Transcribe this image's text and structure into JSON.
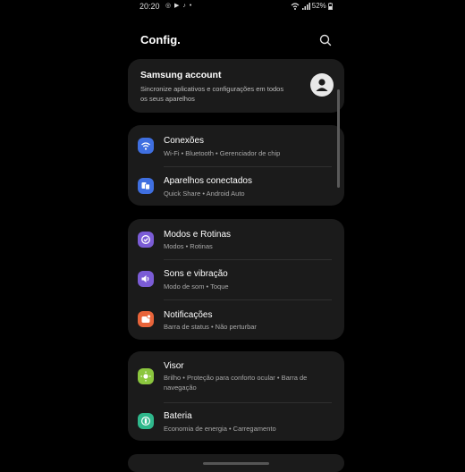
{
  "status": {
    "time": "20:20",
    "left_icons": "◎ ▶ ♪ •",
    "right": "52%"
  },
  "header": {
    "title": "Config."
  },
  "account": {
    "title": "Samsung account",
    "subtitle": "Sincronize aplicativos e configurações em todos os seus aparelhos"
  },
  "group1": [
    {
      "title": "Conexões",
      "subtitle": "Wi-Fi  •  Bluetooth  •  Gerenciador de chip",
      "icon": "wifi-icon",
      "color": "#3f6fe0"
    },
    {
      "title": "Aparelhos conectados",
      "subtitle": "Quick Share  •  Android Auto",
      "icon": "devices-icon",
      "color": "#3f6fe0"
    }
  ],
  "group2": [
    {
      "title": "Modos e Rotinas",
      "subtitle": "Modos  •  Rotinas",
      "icon": "modes-icon",
      "color": "#7b5cd6"
    },
    {
      "title": "Sons e vibração",
      "subtitle": "Modo de som  •  Toque",
      "icon": "sound-icon",
      "color": "#7b5cd6"
    },
    {
      "title": "Notificações",
      "subtitle": "Barra de status  •  Não perturbar",
      "icon": "notification-icon",
      "color": "#e8643a"
    }
  ],
  "group3": [
    {
      "title": "Visor",
      "subtitle": "Brilho  •  Proteção para conforto ocular  •  Barra de navegação",
      "icon": "display-icon",
      "color": "#8bc63e"
    },
    {
      "title": "Bateria",
      "subtitle": "Economia de energia  •  Carregamento",
      "icon": "battery-icon",
      "color": "#2fb88c"
    }
  ]
}
